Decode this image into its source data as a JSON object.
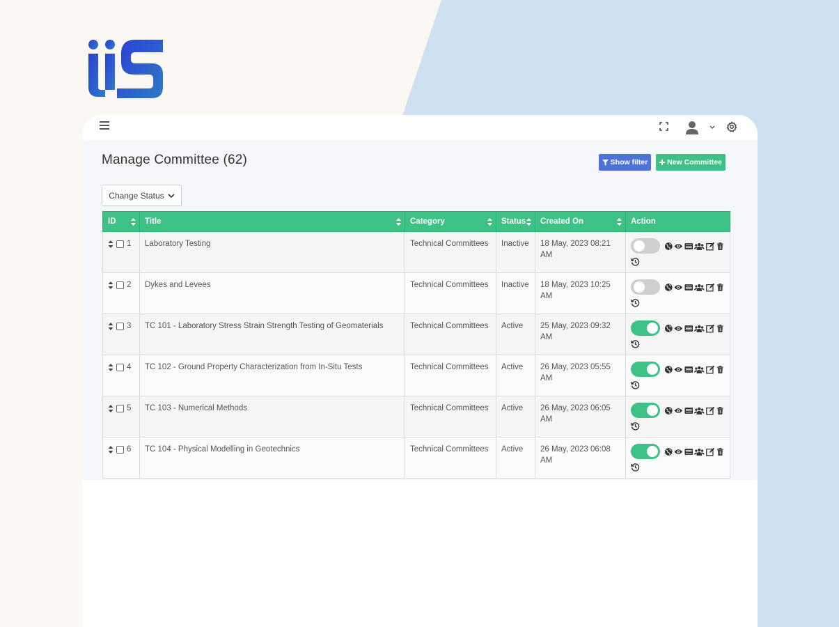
{
  "brand": {
    "logo_text": "iiS",
    "colors": {
      "primary_gradient_start": "#2c3fd6",
      "primary_gradient_end": "#2e7bc4"
    }
  },
  "topbar": {
    "menu_icon": "hamburger-icon",
    "fullscreen_icon": "fullscreen-icon",
    "avatar_icon": "user-avatar-icon",
    "dropdown_icon": "chevron-down-icon",
    "settings_icon": "gear-icon"
  },
  "page": {
    "title": "Manage Committee (62)",
    "show_filter_label": "Show filter",
    "new_committee_label": "New Committee",
    "change_status_label": "Change Status"
  },
  "colors": {
    "accent_green": "#3ec187",
    "filter_blue": "#4e72d8"
  },
  "table": {
    "columns": [
      "ID",
      "Title",
      "Category",
      "Status",
      "Created On",
      "Action"
    ],
    "rows": [
      {
        "id": "1",
        "title": "Laboratory Testing",
        "category": "Technical Committees",
        "status": "Inactive",
        "created_on": "18 May, 2023 08:21 AM",
        "active": false
      },
      {
        "id": "2",
        "title": "Dykes and Levees",
        "category": "Technical Committees",
        "status": "Inactive",
        "created_on": "18 May, 2023 10:25 AM",
        "active": false
      },
      {
        "id": "3",
        "title": "TC 101 - Laboratory Stress Strain Strength Testing of Geomaterials",
        "category": "Technical Committees",
        "status": "Active",
        "created_on": "25 May, 2023 09:32 AM",
        "active": true
      },
      {
        "id": "4",
        "title": "TC 102 - Ground Property Characterization from In-Situ Tests",
        "category": "Technical Committees",
        "status": "Active",
        "created_on": "26 May, 2023 05:55 AM",
        "active": true
      },
      {
        "id": "5",
        "title": "TC 103 - Numerical Methods",
        "category": "Technical Committees",
        "status": "Active",
        "created_on": "26 May, 2023 06:05 AM",
        "active": true
      },
      {
        "id": "6",
        "title": "TC 104 - Physical Modelling in Geotechnics",
        "category": "Technical Committees",
        "status": "Active",
        "created_on": "26 May, 2023 06:08 AM",
        "active": true
      }
    ],
    "action_icons": [
      "globe-icon",
      "eye-icon",
      "list-icon",
      "users-icon",
      "edit-icon",
      "trash-icon",
      "history-icon"
    ]
  }
}
